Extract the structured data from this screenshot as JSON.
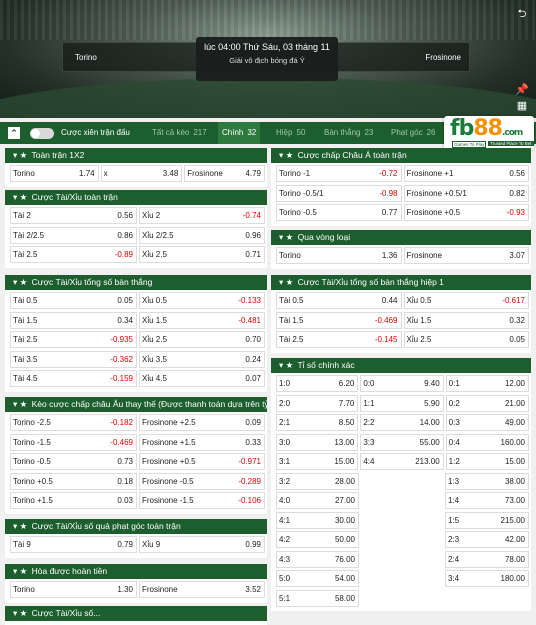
{
  "banner": {
    "home": "Torino",
    "away": "Frosinone",
    "datetime": "lúc 04:00 Thứ Sáu, 03 tháng 11",
    "league": "Giải vô địch bóng đá Ý"
  },
  "tabs": {
    "combo": "Cược xiên trận đấu",
    "items": [
      {
        "label": "Tất cả kèo",
        "count": "217"
      },
      {
        "label": "Chính",
        "count": "32"
      },
      {
        "label": "Hiệp",
        "count": "50"
      },
      {
        "label": "Bàn thắng",
        "count": "23"
      },
      {
        "label": "Phạt góc",
        "count": "26"
      }
    ]
  },
  "logo": {
    "main": "fb",
    "accent": "88",
    "suffix": ".com",
    "tag1": "Games To Play",
    "tag2": "Trusted Place To Bet"
  },
  "markets": [
    {
      "title": "Toàn trận 1X2",
      "rows": [
        [
          [
            "Torino",
            "1.74"
          ],
          [
            "x",
            "3.48"
          ],
          [
            "Frosinone",
            "4.79"
          ]
        ]
      ]
    },
    {
      "title": "Cược Tài/Xỉu toàn trận",
      "rows": [
        [
          [
            "Tài 2",
            "0.56"
          ],
          [
            "Xỉu 2",
            "-0.74"
          ]
        ],
        [
          [
            "Tài 2/2.5",
            "0.86"
          ],
          [
            "Xỉu 2/2.5",
            "0.96"
          ]
        ],
        [
          [
            "Tài 2.5",
            "-0.89"
          ],
          [
            "Xỉu 2.5",
            "0.71"
          ]
        ]
      ]
    },
    {
      "title": "Cược Tài/Xỉu tổng số bàn thắng",
      "rows": [
        [
          [
            "Tài 0.5",
            "0.05"
          ],
          [
            "Xỉu 0.5",
            "-0.133"
          ]
        ],
        [
          [
            "Tài 1.5",
            "0.34"
          ],
          [
            "Xỉu 1.5",
            "-0.481"
          ]
        ],
        [
          [
            "Tài 2.5",
            "-0.935"
          ],
          [
            "Xỉu 2.5",
            "0.70"
          ]
        ],
        [
          [
            "Tài 3.5",
            "-0.362"
          ],
          [
            "Xỉu 3.5",
            "0.24"
          ]
        ],
        [
          [
            "Tài 4.5",
            "-0.159"
          ],
          [
            "Xỉu 4.5",
            "0.07"
          ]
        ]
      ]
    },
    {
      "title": "Kèo cược chấp châu Âu thay thế (Được thanh toán dựa trên tỷ...",
      "rows": [
        [
          [
            "Torino -2.5",
            "-0.182"
          ],
          [
            "Frosinone +2.5",
            "0.09"
          ]
        ],
        [
          [
            "Torino -1.5",
            "-0.469"
          ],
          [
            "Frosinone +1.5",
            "0.33"
          ]
        ],
        [
          [
            "Torino -0.5",
            "0.73"
          ],
          [
            "Frosinone +0.5",
            "-0.971"
          ]
        ],
        [
          [
            "Torino +0.5",
            "0.18"
          ],
          [
            "Frosinone -0.5",
            "-0.289"
          ]
        ],
        [
          [
            "Torino +1.5",
            "0.03"
          ],
          [
            "Frosinone -1.5",
            "-0.106"
          ]
        ]
      ]
    },
    {
      "title": "Cược Tài/Xỉu số quả phạt góc toàn trận",
      "rows": [
        [
          [
            "Tài 9",
            "0.79"
          ],
          [
            "Xỉu 9",
            "0.99"
          ]
        ]
      ]
    },
    {
      "title": "Hòa được hoàn tiền",
      "rows": [
        [
          [
            "Torino",
            "1.30"
          ],
          [
            "Frosinone",
            "3.52"
          ]
        ]
      ]
    },
    {
      "title": "Cược chấp Châu Á toàn trận",
      "rows": [
        [
          [
            "Torino -1",
            "-0.72"
          ],
          [
            "Frosinone +1",
            "0.56"
          ]
        ],
        [
          [
            "Torino -0.5/1",
            "-0.98"
          ],
          [
            "Frosinone +0.5/1",
            "0.82"
          ]
        ],
        [
          [
            "Torino -0.5",
            "0.77"
          ],
          [
            "Frosinone +0.5",
            "-0.93"
          ]
        ]
      ]
    },
    {
      "title": "Qua vòng loại",
      "rows": [
        [
          [
            "Torino",
            "1.36"
          ],
          [
            "Frosinone",
            "3.07"
          ]
        ]
      ]
    },
    {
      "title": "Cược Tài/Xỉu tổng số bàn thắng hiệp 1",
      "rows": [
        [
          [
            "Tài 0.5",
            "0.44"
          ],
          [
            "Xỉu 0.5",
            "-0.617"
          ]
        ],
        [
          [
            "Tài 1.5",
            "-0.469"
          ],
          [
            "Xỉu 1.5",
            "0.32"
          ]
        ],
        [
          [
            "Tài 2.5",
            "-0.145"
          ],
          [
            "Xỉu 2.5",
            "0.05"
          ]
        ]
      ]
    },
    {
      "title": "Tỉ số chính xác",
      "rows": [
        [
          [
            "1:0",
            "6.20"
          ],
          [
            "0:0",
            "9.40"
          ],
          [
            "0:1",
            "12.00"
          ]
        ],
        [
          [
            "2:0",
            "7.70"
          ],
          [
            "1:1",
            "5.90"
          ],
          [
            "0:2",
            "21.00"
          ]
        ],
        [
          [
            "2:1",
            "8.50"
          ],
          [
            "2:2",
            "14.00"
          ],
          [
            "0:3",
            "49.00"
          ]
        ],
        [
          [
            "3:0",
            "13.00"
          ],
          [
            "3:3",
            "55.00"
          ],
          [
            "0:4",
            "160.00"
          ]
        ],
        [
          [
            "3:1",
            "15.00"
          ],
          [
            "4:4",
            "213.00"
          ],
          [
            "1:2",
            "15.00"
          ]
        ],
        [
          [
            "3:2",
            "28.00"
          ],
          null,
          [
            "1:3",
            "38.00"
          ]
        ],
        [
          [
            "4:0",
            "27.00"
          ],
          null,
          [
            "1:4",
            "73.00"
          ]
        ],
        [
          [
            "4:1",
            "30.00"
          ],
          null,
          [
            "1:5",
            "215.00"
          ]
        ],
        [
          [
            "4:2",
            "50.00"
          ],
          null,
          [
            "2:3",
            "42.00"
          ]
        ],
        [
          [
            "4:3",
            "76.00"
          ],
          null,
          [
            "2:4",
            "78.00"
          ]
        ],
        [
          [
            "5:0",
            "54.00"
          ],
          null,
          [
            "3:4",
            "180.00"
          ]
        ],
        [
          [
            "5:1",
            "58.00"
          ],
          null,
          null
        ]
      ]
    },
    {
      "title": "Cược Tài/Xỉu số...",
      "rows": []
    }
  ]
}
